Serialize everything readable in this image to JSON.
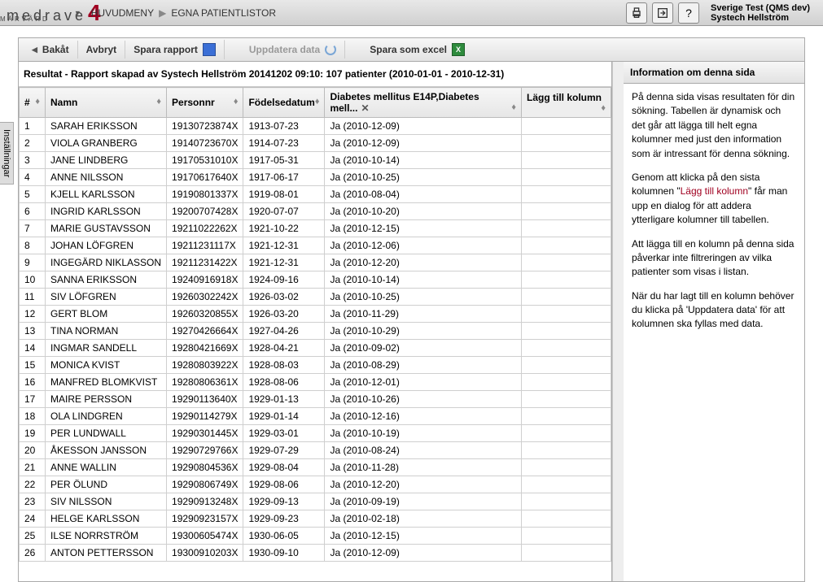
{
  "top": {
    "logo_main": "medrave",
    "logo_sub": "PRIMÄRVÅRD",
    "crumb1": "HUVUDMENY",
    "crumb2": "EGNA PATIENTLISTOR",
    "user_line1": "Sverige Test (QMS dev)",
    "user_line2": "Systech Hellström"
  },
  "toolbar": {
    "back": "Bakåt",
    "cancel": "Avbryt",
    "save_report": "Spara rapport",
    "update_data": "Uppdatera data",
    "save_excel": "Spara som excel"
  },
  "result_title": "Resultat - Rapport skapad av Systech Hellström 20141202 09:10: 107 patienter (2010-01-01 - 2010-12-31)",
  "columns": {
    "num": "#",
    "name": "Namn",
    "personnr": "Personnr",
    "dob": "Födelsedatum",
    "diag": "Diabetes mellitus E14P,Diabetes mell...",
    "add": "Lägg till kolumn"
  },
  "rows": [
    {
      "n": "1",
      "name": "SARAH ERIKSSON",
      "pnr": "19130723874X",
      "dob": "1913-07-23",
      "diag": "Ja (2010-12-09)"
    },
    {
      "n": "2",
      "name": "VIOLA GRANBERG",
      "pnr": "19140723670X",
      "dob": "1914-07-23",
      "diag": "Ja (2010-12-09)"
    },
    {
      "n": "3",
      "name": "JANE LINDBERG",
      "pnr": "19170531010X",
      "dob": "1917-05-31",
      "diag": "Ja (2010-10-14)"
    },
    {
      "n": "4",
      "name": "ANNE NILSSON",
      "pnr": "19170617640X",
      "dob": "1917-06-17",
      "diag": "Ja (2010-10-25)"
    },
    {
      "n": "5",
      "name": "KJELL KARLSSON",
      "pnr": "19190801337X",
      "dob": "1919-08-01",
      "diag": "Ja (2010-08-04)"
    },
    {
      "n": "6",
      "name": "INGRID KARLSSON",
      "pnr": "19200707428X",
      "dob": "1920-07-07",
      "diag": "Ja (2010-10-20)"
    },
    {
      "n": "7",
      "name": "MARIE GUSTAVSSON",
      "pnr": "19211022262X",
      "dob": "1921-10-22",
      "diag": "Ja (2010-12-15)"
    },
    {
      "n": "8",
      "name": "JOHAN LÖFGREN",
      "pnr": "19211231117X",
      "dob": "1921-12-31",
      "diag": "Ja (2010-12-06)"
    },
    {
      "n": "9",
      "name": "INGEGÄRD NIKLASSON",
      "pnr": "19211231422X",
      "dob": "1921-12-31",
      "diag": "Ja (2010-12-20)"
    },
    {
      "n": "10",
      "name": "SANNA ERIKSSON",
      "pnr": "19240916918X",
      "dob": "1924-09-16",
      "diag": "Ja (2010-10-14)"
    },
    {
      "n": "11",
      "name": "SIV LÖFGREN",
      "pnr": "19260302242X",
      "dob": "1926-03-02",
      "diag": "Ja (2010-10-25)"
    },
    {
      "n": "12",
      "name": "GERT BLOM",
      "pnr": "19260320855X",
      "dob": "1926-03-20",
      "diag": "Ja (2010-11-29)"
    },
    {
      "n": "13",
      "name": "TINA NORMAN",
      "pnr": "19270426664X",
      "dob": "1927-04-26",
      "diag": "Ja (2010-10-29)"
    },
    {
      "n": "14",
      "name": "INGMAR SANDELL",
      "pnr": "19280421669X",
      "dob": "1928-04-21",
      "diag": "Ja (2010-09-02)"
    },
    {
      "n": "15",
      "name": "MONICA KVIST",
      "pnr": "19280803922X",
      "dob": "1928-08-03",
      "diag": "Ja (2010-08-29)"
    },
    {
      "n": "16",
      "name": "MANFRED BLOMKVIST",
      "pnr": "19280806361X",
      "dob": "1928-08-06",
      "diag": "Ja (2010-12-01)"
    },
    {
      "n": "17",
      "name": "MAIRE PERSSON",
      "pnr": "19290113640X",
      "dob": "1929-01-13",
      "diag": "Ja (2010-10-26)"
    },
    {
      "n": "18",
      "name": "OLA LINDGREN",
      "pnr": "19290114279X",
      "dob": "1929-01-14",
      "diag": "Ja (2010-12-16)"
    },
    {
      "n": "19",
      "name": "PER LUNDWALL",
      "pnr": "19290301445X",
      "dob": "1929-03-01",
      "diag": "Ja (2010-10-19)"
    },
    {
      "n": "20",
      "name": "ÅKESSON JANSSON",
      "pnr": "19290729766X",
      "dob": "1929-07-29",
      "diag": "Ja (2010-08-24)"
    },
    {
      "n": "21",
      "name": "ANNE WALLIN",
      "pnr": "19290804536X",
      "dob": "1929-08-04",
      "diag": "Ja (2010-11-28)"
    },
    {
      "n": "22",
      "name": "PER ÖLUND",
      "pnr": "19290806749X",
      "dob": "1929-08-06",
      "diag": "Ja (2010-12-20)"
    },
    {
      "n": "23",
      "name": "SIV NILSSON",
      "pnr": "19290913248X",
      "dob": "1929-09-13",
      "diag": "Ja (2010-09-19)"
    },
    {
      "n": "24",
      "name": "HELGE KARLSSON",
      "pnr": "19290923157X",
      "dob": "1929-09-23",
      "diag": "Ja (2010-02-18)"
    },
    {
      "n": "25",
      "name": "ILSE NORRSTRÖM",
      "pnr": "19300605474X",
      "dob": "1930-06-05",
      "diag": "Ja (2010-12-15)"
    },
    {
      "n": "26",
      "name": "ANTON PETTERSSON",
      "pnr": "19300910203X",
      "dob": "1930-09-10",
      "diag": "Ja (2010-12-09)"
    }
  ],
  "side": {
    "title": "Information om denna sida",
    "p1a": "På denna sida visas resultaten för din sökning. Tabellen är dynamisk och det går att lägga till helt egna kolumner med just den information som är intressant för denna sökning.",
    "p2a": "Genom att klicka på den sista kolumnen \"",
    "p2b": "Lägg till kolumn",
    "p2c": "\" får man upp en dialog för att addera ytterligare kolumner till tabellen.",
    "p3": "Att lägga till en kolumn på denna sida påverkar inte filtreringen av vilka patienter som visas i listan.",
    "p4": "När du har lagt till en kolumn behöver du klicka på 'Uppdatera data' för att kolumnen ska fyllas med data."
  },
  "settings_tab": "Inställningar"
}
